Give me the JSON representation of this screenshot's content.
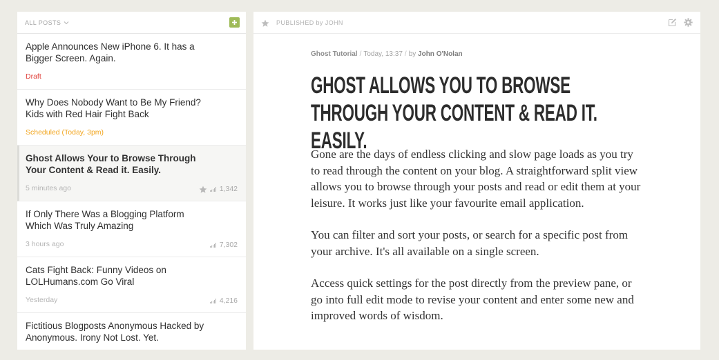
{
  "list": {
    "filter_label": "ALL POSTS",
    "posts": [
      {
        "title": "Apple Announces New iPhone 6. It has a Bigger Screen. Again.",
        "status": "Draft",
        "status_type": "draft",
        "views": ""
      },
      {
        "title": "Why Does Nobody Want to Be My Friend? Kids with Red Hair Fight Back",
        "status": "Scheduled (Today, 3pm)",
        "status_type": "scheduled",
        "views": ""
      },
      {
        "title": "Ghost Allows Your to Browse Through Your Content & Read it. Easily.",
        "status": "5 minutes ago",
        "status_type": "published",
        "views": "1,342",
        "starred": true
      },
      {
        "title": "If Only There Was a Blogging Platform Which Was Truly Amazing",
        "status": "3 hours ago",
        "status_type": "published",
        "views": "7,302"
      },
      {
        "title": "Cats Fight Back: Funny Videos on LOLHumans.com Go Viral",
        "status": "Yesterday",
        "status_type": "published",
        "views": "4,216"
      },
      {
        "title": "Fictitious Blogposts Anonymous Hacked by Anonymous. Irony Not Lost. Yet.",
        "status": "",
        "status_type": "published",
        "views": ""
      }
    ]
  },
  "preview": {
    "status_label": "PUBLISHED by JOHN",
    "byline": {
      "tag": "Ghost Tutorial",
      "date": "Today, 13:37",
      "by": "by",
      "author": "John O'Nolan"
    },
    "headline": "Ghost allows you to browse through your content & read it. Easily.",
    "paragraphs": [
      "Gone are the days of endless clicking and slow page loads as you try to read through the content on your blog. A straightforward split view allows you to browse through your posts and read or edit them at your leisure. It works just like your favourite email application.",
      "You can filter and sort your posts, or search for a specific post from your archive. It's all available on a single screen.",
      "Access quick settings for the post directly from the preview pane, or go into full edit mode to revise your content and enter some new and improved words of wisdom."
    ]
  },
  "colors": {
    "background": "#edece6",
    "add_button": "#9fbb58",
    "draft": "#e0413b",
    "scheduled": "#f2a51d"
  },
  "icons": {
    "filter": "chevron-down-icon",
    "add": "plus-icon",
    "star": "star-icon",
    "views": "signal-bars-icon",
    "edit": "edit-icon",
    "settings": "gear-icon"
  }
}
